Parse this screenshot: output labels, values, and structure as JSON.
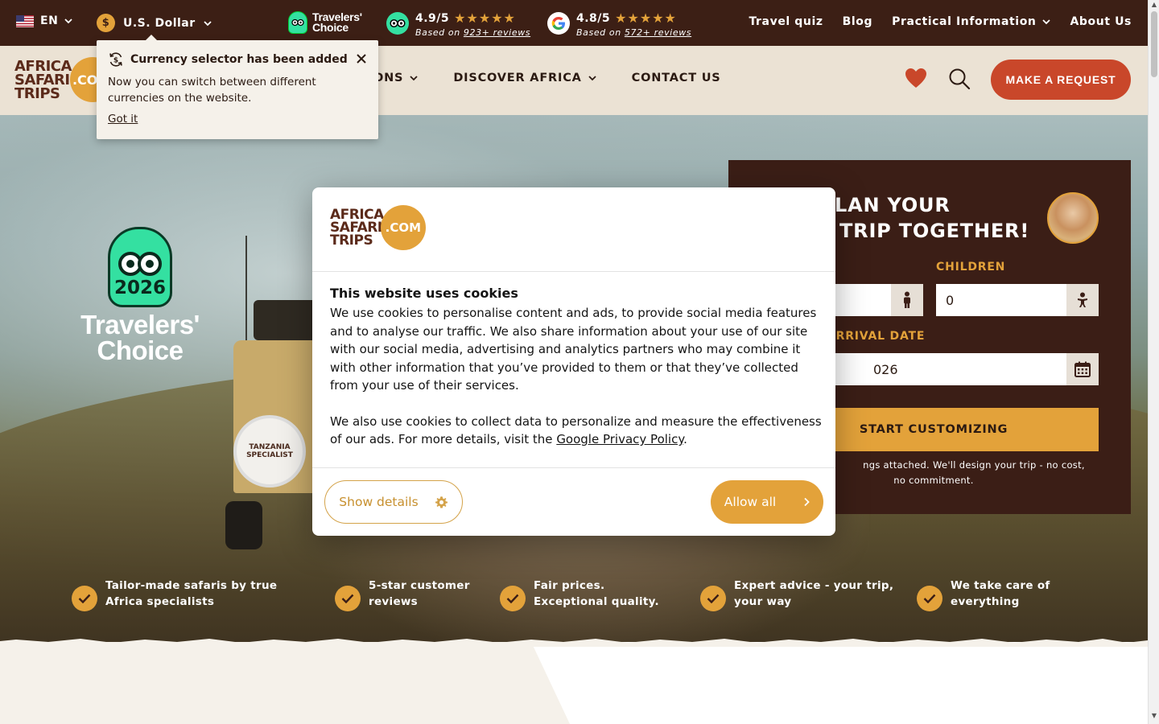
{
  "top_bar": {
    "language": "EN",
    "currency": "U.S. Dollar",
    "currency_symbol": "$",
    "travelers_choice_label": "Travelers' Choice",
    "tripadvisor": {
      "score": "4.9/5",
      "based_prefix": "Based on ",
      "reviews": "923+ reviews"
    },
    "google": {
      "score": "4.8/5",
      "based_prefix": "Based on ",
      "reviews": "572+ reviews"
    },
    "nav": [
      "Travel quiz",
      "Blog",
      "Practical Information",
      "About Us"
    ]
  },
  "header": {
    "brand_line1": "AFRICA",
    "brand_line2": "SAFARI",
    "brand_line3": "TRIPS",
    "brand_suffix": ".COM",
    "nav": [
      "DESTINATIONS",
      "DISCOVER AFRICA",
      "CONTACT US"
    ],
    "nav_visible_first": "ONS",
    "cta": "MAKE A REQUEST"
  },
  "hero": {
    "tc_year": "2026",
    "tc_title_line1": "Travelers'",
    "tc_title_line2": "Choice",
    "tire_text_line1": "TANZANIA",
    "tire_text_line2": "SPECIALIST"
  },
  "form": {
    "title_line1": "LAN YOUR",
    "title_line2": "TRIP TOGETHER!",
    "children_label": "CHILDREN",
    "children_value": "0",
    "arrival_label": "ARRIVAL DATE",
    "arrival_value_visible": "026",
    "submit": "START CUSTOMIZING",
    "fine_line1": "ngs attached. We'll design your trip - no cost,",
    "fine_line2": "no commitment."
  },
  "benefits": [
    {
      "line1": "Tailor-made safaris by true",
      "line2": "Africa specialists"
    },
    {
      "line1": "5-star customer",
      "line2": "reviews"
    },
    {
      "line1": "Fair prices.",
      "line2": "Exceptional quality."
    },
    {
      "line1": "Expert advice - your trip,",
      "line2": "your way"
    },
    {
      "line1": "We take care of",
      "line2": "everything"
    }
  ],
  "currency_popover": {
    "title": "Currency selector has been added",
    "body": "Now you can switch between different currencies on the website.",
    "action": "Got it"
  },
  "cookie_dialog": {
    "title": "This website uses cookies",
    "paragraph1": "We use cookies to personalise content and ads, to provide social media features and to analyse our traffic. We also share information about your use of our site with our social media, advertising and analytics partners who may combine it with other information that you’ve provided to them or that they’ve collected from your use of their services.",
    "paragraph2_prefix": "We also use cookies to collect data to personalize and measure the effectiveness of our ads. For more details, visit the ",
    "paragraph2_link": "Google Privacy Policy",
    "paragraph2_suffix": ".",
    "show_details": "Show details",
    "allow_all": "Allow all"
  },
  "colors": {
    "dark_brown": "#3c1f15",
    "orange": "#e3a23a",
    "red_cta": "#c9472a",
    "cream": "#ebe2d4"
  },
  "icons": {
    "language_flag": "us-flag-icon",
    "currency": "dollar-coin-icon",
    "tripadvisor": "tripadvisor-owl-icon",
    "google": "google-g-icon",
    "wishlist": "heart-icon",
    "search": "search-icon",
    "adult": "person-icon",
    "child": "child-icon",
    "calendar": "calendar-icon",
    "popover_title": "currency-exchange-icon",
    "close": "close-icon",
    "details": "gear-icon",
    "allow": "chevron-right-icon",
    "benefit": "check-icon"
  }
}
